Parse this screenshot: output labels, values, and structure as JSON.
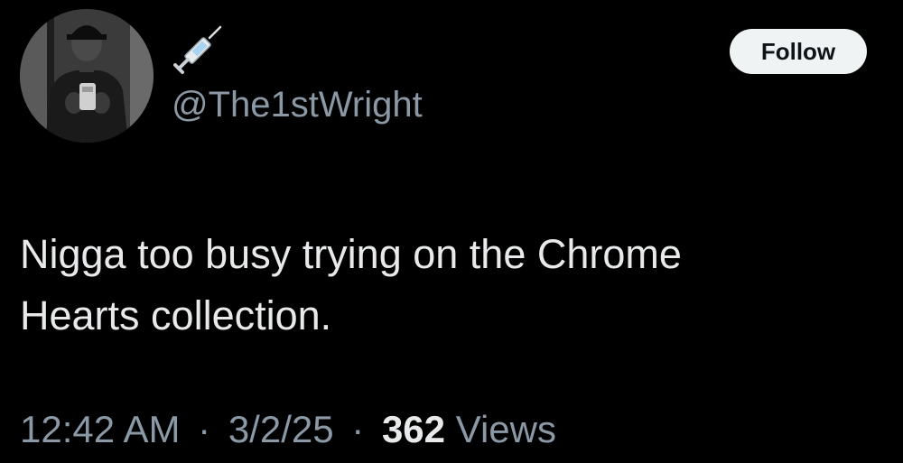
{
  "author": {
    "display_name_emoji_icon": "syringe-icon",
    "handle": "@The1stWright"
  },
  "follow_button": {
    "label": "Follow"
  },
  "tweet": {
    "text_line1": "Nigga too busy trying on the Chrome",
    "text_line2": "Hearts collection."
  },
  "meta": {
    "time": "12:42 AM",
    "separator": "·",
    "date": "3/2/25",
    "views_count": "362",
    "views_label": "Views"
  },
  "colors": {
    "background": "#000000",
    "primary_text": "#e7e9ea",
    "secondary_text": "#8b98a5",
    "button_bg": "#eff3f4"
  }
}
